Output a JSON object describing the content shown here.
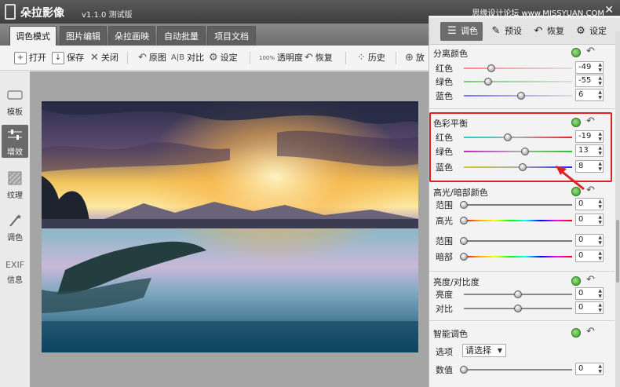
{
  "window": {
    "title": "朵拉影像",
    "version": "v1.1.0 测试版",
    "watermark": "思缘设计论坛 www.MISSYUAN.COM"
  },
  "tabs": [
    {
      "label": "调色模式",
      "active": true
    },
    {
      "label": "图片编辑",
      "active": false
    },
    {
      "label": "朵拉画映",
      "active": false
    },
    {
      "label": "自动批量",
      "active": false
    },
    {
      "label": "项目文档",
      "active": false
    }
  ],
  "toolbar": {
    "open": "打开",
    "save": "保存",
    "close": "关闭",
    "original": "原图",
    "compare": "对比",
    "settings": "设定",
    "opacity_prefix": "100%",
    "opacity": "透明度",
    "restore": "恢复",
    "history": "历史",
    "zoom": "放"
  },
  "sidebar": [
    {
      "label": "模板",
      "icon": "template-icon",
      "active": false
    },
    {
      "label": "增效",
      "icon": "sliders-icon",
      "active": true
    },
    {
      "label": "纹理",
      "icon": "texture-icon",
      "active": false
    },
    {
      "label": "调色",
      "icon": "magic-wand-icon",
      "active": false
    },
    {
      "label": "信息",
      "icon": "exif-icon",
      "prefix": "EXIF",
      "active": false
    }
  ],
  "panel": {
    "tabs": {
      "color": "调色",
      "preset": "预设",
      "restore": "恢复",
      "settings": "设定"
    },
    "split_toning": {
      "title": "分离颜色",
      "rows": [
        {
          "label": "红色",
          "value": "-49",
          "level": 0.255
        },
        {
          "label": "绿色",
          "value": "-55",
          "level": 0.225
        },
        {
          "label": "蓝色",
          "value": "6",
          "level": 0.53
        }
      ]
    },
    "color_balance": {
      "title": "色彩平衡",
      "rows": [
        {
          "label": "红色",
          "value": "-19",
          "level": 0.405
        },
        {
          "label": "绿色",
          "value": "13",
          "level": 0.565
        },
        {
          "label": "蓝色",
          "value": "8",
          "level": 0.54
        }
      ]
    },
    "highlight_shadow": {
      "title": "高光/暗部颜色",
      "rows": [
        {
          "label": "范围",
          "value": "0",
          "level": 0.0
        },
        {
          "label": "高光",
          "value": "0",
          "level": 0.0
        },
        {
          "label": "范围",
          "value": "0",
          "level": 0.0
        },
        {
          "label": "暗部",
          "value": "0",
          "level": 0.0
        }
      ]
    },
    "brightness_contrast": {
      "title": "亮度/对比度",
      "rows": [
        {
          "label": "亮度",
          "value": "0",
          "level": 0.5
        },
        {
          "label": "对比",
          "value": "0",
          "level": 0.5
        }
      ]
    },
    "smart_color": {
      "title": "智能调色",
      "option_label": "选项",
      "option_value": "请选择",
      "value_label": "数值",
      "value": "0",
      "level": 0.0
    }
  },
  "colors": {
    "accent_red": "#e02020",
    "toggle_green": "#2f9a2a"
  }
}
